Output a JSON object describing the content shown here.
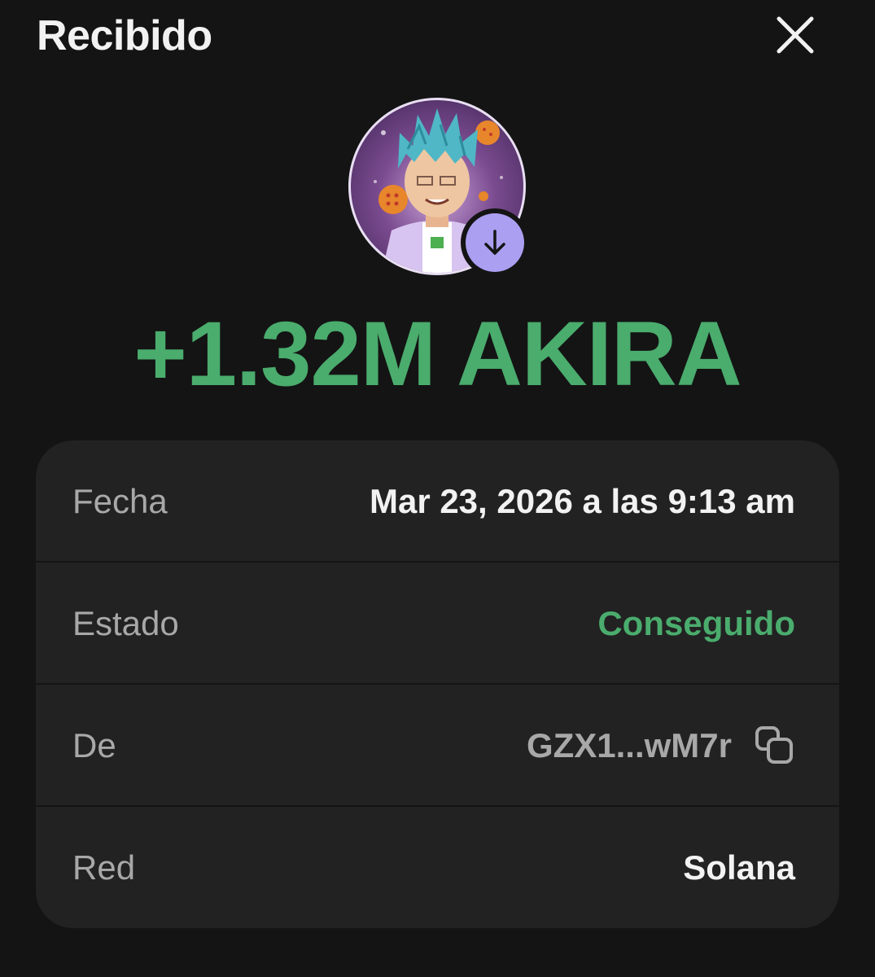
{
  "header": {
    "title": "Recibido"
  },
  "transaction": {
    "amount": "+1.32M AKIRA",
    "status_icon": "arrow-down-icon"
  },
  "details": {
    "date_label": "Fecha",
    "date_value": "Mar 23, 2026 a las 9:13 am",
    "status_label": "Estado",
    "status_value": "Conseguido",
    "from_label": "De",
    "from_value": "GZX1...wM7r",
    "network_label": "Red",
    "network_value": "Solana"
  },
  "colors": {
    "background": "#141414",
    "card": "#222222",
    "success_green": "#4aac6d",
    "badge_purple": "#ab9ff2",
    "muted_text": "#a8a8a8"
  }
}
